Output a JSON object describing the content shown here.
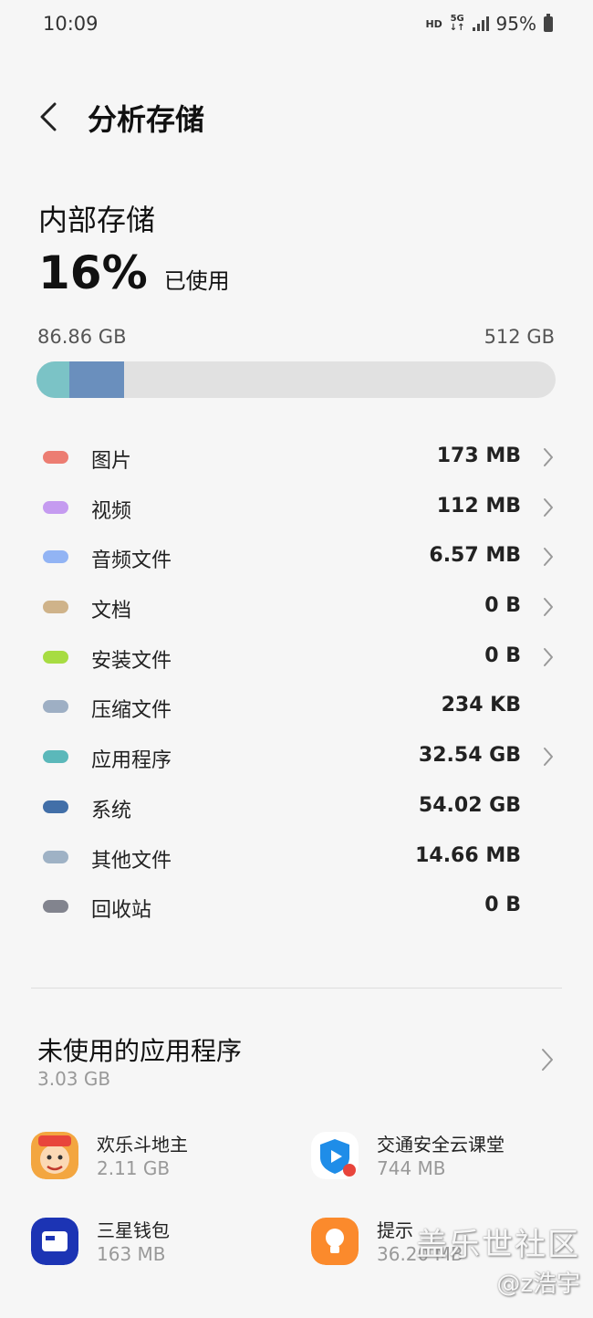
{
  "status": {
    "time": "10:09",
    "hd": "HD",
    "network": "5G",
    "battery": "95%"
  },
  "header": {
    "title": "分析存储"
  },
  "storage": {
    "label": "内部存储",
    "percent": "16%",
    "used_label": "已使用",
    "used_amount": "86.86 GB",
    "total_amount": "512 GB",
    "bar_segments": [
      {
        "name": "应用程序",
        "fraction": 0.06355,
        "color": "#7bc3c6"
      },
      {
        "name": "系统",
        "fraction": 0.1055,
        "color": "#6a8fbd"
      }
    ]
  },
  "categories": [
    {
      "label": "图片",
      "size": "173 MB",
      "color": "#ec7d72",
      "chevron": true
    },
    {
      "label": "视频",
      "size": "112 MB",
      "color": "#c59bf0",
      "chevron": true
    },
    {
      "label": "音频文件",
      "size": "6.57 MB",
      "color": "#92b4f4",
      "chevron": true
    },
    {
      "label": "文档",
      "size": "0 B",
      "color": "#cfb38a",
      "chevron": true
    },
    {
      "label": "安装文件",
      "size": "0 B",
      "color": "#a7dc42",
      "chevron": true
    },
    {
      "label": "压缩文件",
      "size": "234 KB",
      "color": "#9eafc4",
      "chevron": false
    },
    {
      "label": "应用程序",
      "size": "32.54 GB",
      "color": "#5bb8ba",
      "chevron": true
    },
    {
      "label": "系统",
      "size": "54.02 GB",
      "color": "#426fa8",
      "chevron": false
    },
    {
      "label": "其他文件",
      "size": "14.66 MB",
      "color": "#9fb2c5",
      "chevron": false
    },
    {
      "label": "回收站",
      "size": "0 B",
      "color": "#82848e",
      "chevron": false
    }
  ],
  "unused": {
    "title": "未使用的应用程序",
    "size": "3.03 GB",
    "apps": [
      {
        "name": "欢乐斗地主",
        "size": "2.11 GB",
        "icon": "doudizhu-icon"
      },
      {
        "name": "交通安全云课堂",
        "size": "744 MB",
        "icon": "traffic-class-icon"
      },
      {
        "name": "三星钱包",
        "size": "163 MB",
        "icon": "samsung-wallet-icon"
      },
      {
        "name": "提示",
        "size": "36.20 MB",
        "icon": "tips-icon"
      }
    ]
  },
  "watermark": {
    "main": "盖乐世社区",
    "sub": "@z浩宇"
  }
}
